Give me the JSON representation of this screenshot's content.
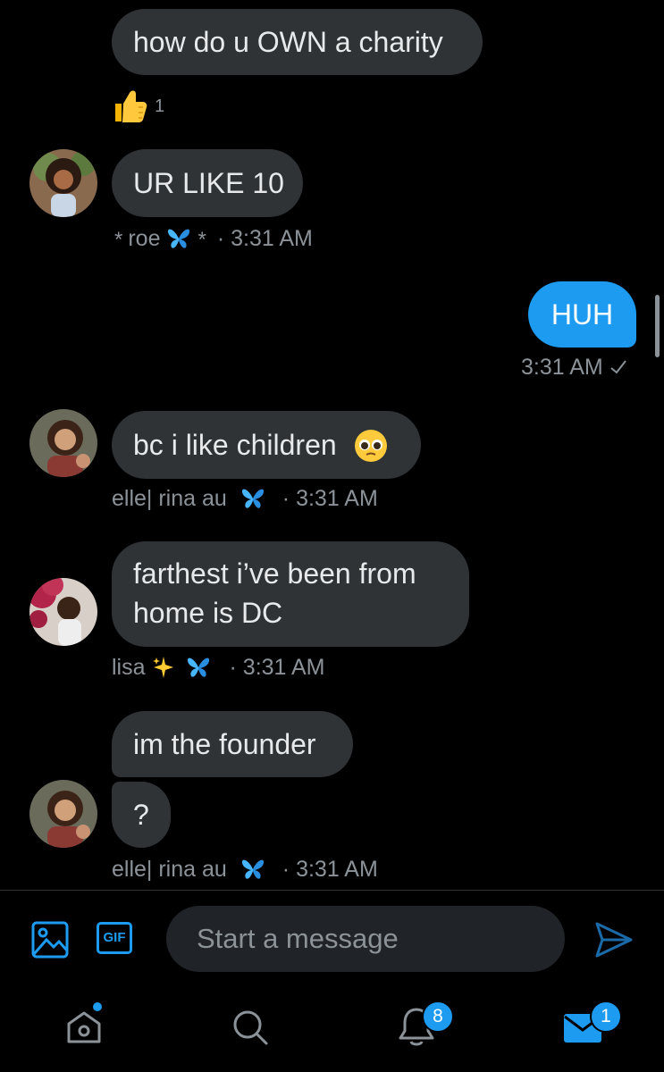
{
  "messages": {
    "m1": {
      "text": "how do u OWN a charity",
      "reaction_count": "1"
    },
    "m2": {
      "text": "UR LIKE 10",
      "sender_star1": "*",
      "sender_name": "roe",
      "sender_star2": "*",
      "time": "· 3:31 AM"
    },
    "m3": {
      "text": "HUH",
      "time": "3:31 AM"
    },
    "m4": {
      "text": "bc i like children",
      "sender_name": "elle| rina au",
      "time": "· 3:31 AM"
    },
    "m5": {
      "text": "farthest i’ve been from home is DC",
      "sender_name": "lisa",
      "time": "· 3:31 AM"
    },
    "m6": {
      "text": "im the founder"
    },
    "m7": {
      "text": "?",
      "sender_name": "elle| rina au",
      "time": "· 3:31 AM"
    }
  },
  "composer": {
    "placeholder": "Start a message",
    "gif_label": "GIF"
  },
  "nav": {
    "notifications_badge": "8",
    "messages_badge": "1"
  },
  "colors": {
    "accent": "#1d9bf0",
    "bubble_incoming": "#2f3336",
    "background": "#000000"
  }
}
